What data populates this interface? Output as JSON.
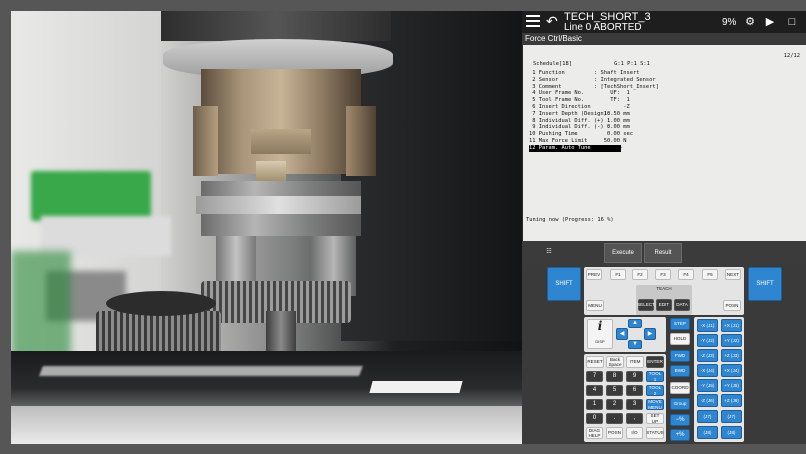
{
  "status_bar": {
    "program_name": "TECH_SHORT_3",
    "program_status": "Line 0 ABORTED",
    "override": "9%",
    "icons": [
      "menu-icon",
      "back-icon",
      "robot-status-icon",
      "forward-icon",
      "page-icon"
    ]
  },
  "screen": {
    "title": "Force Ctrl/Basic",
    "page_count": "12/12",
    "schedule_header": "Schedule[18]             G:1 P:1 S:1",
    "params": [
      {
        "label": " 1 Function",
        "value": ": Shaft Insert"
      },
      {
        "label": " 2 Sensor",
        "value": ": Integrated Sensor"
      },
      {
        "label": " 3 Comment",
        "value": ": [TechShort_Insert]"
      },
      {
        "label": " 4 User Frame No.",
        "value": "     UF:  1"
      },
      {
        "label": " 5 Tool Frame No.",
        "value": "     TF:  1"
      },
      {
        "label": " 6 Insert Direction",
        "value": "         -Z"
      },
      {
        "label": " 7 Insert Depth (Design):",
        "value": "   10.50 mm"
      },
      {
        "label": " 8 Individual Diff. (+) :",
        "value": "    1.00 mm"
      },
      {
        "label": " 9 Individual Diff. (-) :",
        "value": "    0.00 mm"
      },
      {
        "label": "10 Pushing Time",
        "value": "    0.00 sec"
      },
      {
        "label": "11 Max Force Limit",
        "value": "   50.00 N"
      },
      {
        "label": "12 Param. Auto Tune",
        "value": "   ------"
      }
    ],
    "tuning_text": "Tuning now (Progress: 16 %)"
  },
  "soft_buttons": {
    "grid_icon": "grid-icon",
    "execute": "Execute",
    "result": "Result"
  },
  "keypad": {
    "shift_left": "SHIFT",
    "shift_right": "SHIFT",
    "prev": "PREV",
    "f1": "F1",
    "f2": "F2",
    "f3": "F3",
    "f4": "F4",
    "f5": "F5",
    "next": "NEXT",
    "menu": "MENU",
    "teach": "TEACH",
    "select": "SELECT",
    "edit": "EDIT",
    "data": "DATA",
    "posn_top": "POSN",
    "info_icon": "i",
    "disp": "DISP",
    "step": "STEP",
    "hold": "HOLD",
    "fwd": "FWD",
    "bwd": "BWD",
    "reset": "RESET",
    "backspace": "Back Space",
    "item": "ITEM",
    "enter": "ENTER",
    "tool1": "TOOL 1",
    "tool2": "TOOL 2",
    "move_menu": "MOVE MENU",
    "setup": "SET UP",
    "coord": "COORD",
    "group": "Group",
    "digits": [
      "7",
      "8",
      "9",
      "4",
      "5",
      "6",
      "1",
      "2",
      "3",
      "0",
      ".",
      ","
    ],
    "diag": "DIAG HELP",
    "posn_bottom": "POSN",
    "io": "I/O",
    "status": "STATUS",
    "jog_neg": [
      "-X (J1)",
      "-Y (J2)",
      "-Z (J3)",
      "-X (J4)",
      "-Y (J5)",
      "-Z (J6)",
      "(J7)",
      "(J8)"
    ],
    "jog_pos": [
      "+X (J1)",
      "+Y (J2)",
      "+Z (J3)",
      "+X (J4)",
      "+Y (J5)",
      "+Z (J6)",
      "(J7)",
      "(J8)"
    ]
  }
}
